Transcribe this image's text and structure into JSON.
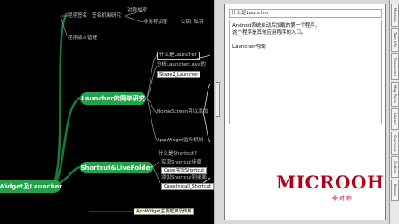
{
  "mindmap": {
    "root": "Widget及Launcher",
    "top_items": [
      "对称加密",
      "程序签名",
      "非对称加密",
      "公钥, 私钥",
      "程序版本管理"
    ],
    "top_items_extra": "签名机制研究",
    "launcher_node": "Launcher的简单研究",
    "launcher_children": [
      "什么是Launcher",
      "分析Launcher.java的",
      "Stage2_Launcher",
      "HomeScreen可以添加",
      "AppWidget监听机制"
    ],
    "shortcut_node": "Shortcut&LiveFolder",
    "shortcut_children": [
      "什么是Shortcut?",
      "实现Shortcut步骤",
      "Case:实现Shortcut",
      "添加Shortcut到桌面",
      "Case:Install_Shortcut"
    ],
    "bottom_item": "AppWidget主要框架及作用"
  },
  "note": {
    "title": "什么是Launcher",
    "lines": [
      "Android系统启动后加载的第一个程序，",
      "这个程序是其他应用程序的入口。",
      "",
      "Launcher构成:"
    ]
  },
  "watermark": {
    "text": "MICROOH",
    "sub": "非 对 称"
  },
  "side_tabs": [
    "Markers",
    "Task Info",
    "Resources",
    "Map Parts",
    "Library",
    "Overview",
    "Outline",
    "Browse"
  ],
  "colors": {
    "pill": "#22a24a",
    "pill_root": "#22a24a",
    "link": "#1a7a3a",
    "watermark": "#b0001a"
  }
}
